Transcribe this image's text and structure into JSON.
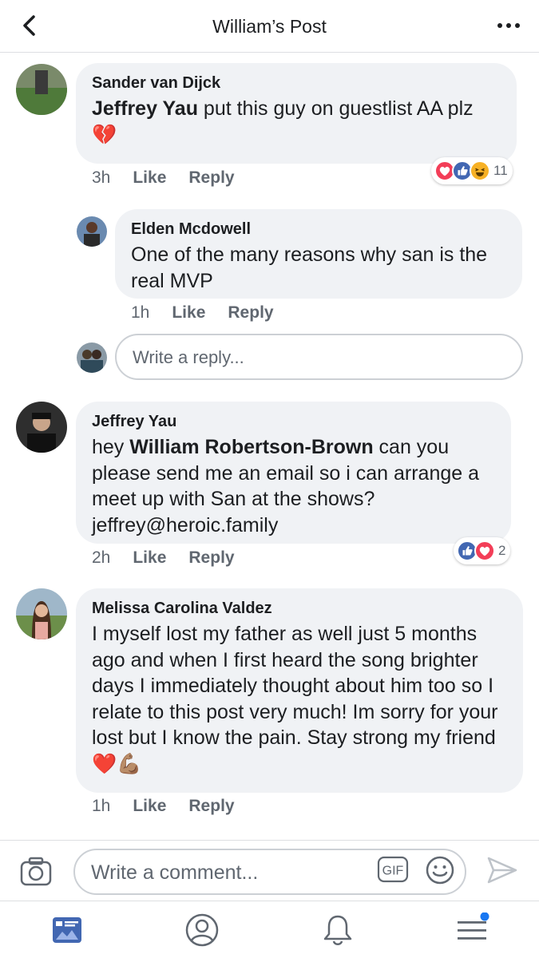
{
  "header": {
    "title": "William’s Post"
  },
  "comments": [
    {
      "author": "Sander van Dijck",
      "mention": "Jeffrey Yau",
      "text": " put this guy on guestlist AA plz",
      "emoji": "💔",
      "time": "3h",
      "like_label": "Like",
      "reply_label": "Reply",
      "reaction_count": "11"
    },
    {
      "author": "Elden Mcdowell",
      "text": "One of the many reasons why san is the real MVP",
      "time": "1h",
      "like_label": "Like",
      "reply_label": "Reply"
    },
    {
      "author": "Jeffrey Yau",
      "text_before": "hey ",
      "mention": "William Robertson-Brown",
      "text_after": " can you please send me an email so i can arrange a meet up with San at the shows? jeffrey@heroic.family",
      "time": "2h",
      "like_label": "Like",
      "reply_label": "Reply",
      "reaction_count": "2"
    },
    {
      "author": "Melissa Carolina Valdez",
      "text": "I myself lost my father as well just 5 months ago and when I first heard the song brighter days I immediately thought about him too so I relate to this post very much! Im sorry for your lost but I know the pain. Stay strong my friend ",
      "emoji": "❤️💪🏽",
      "time": "1h",
      "like_label": "Like",
      "reply_label": "Reply"
    }
  ],
  "reply_box": {
    "placeholder": "Write a reply..."
  },
  "composer": {
    "placeholder": "Write a comment...",
    "gif_label": "GIF"
  },
  "colors": {
    "accent": "#4267b2",
    "love": "#f33e58",
    "haha": "#f7b125",
    "notification_dot": "#1877f2",
    "bubble": "#f0f2f5",
    "meta": "#606770"
  },
  "icons": [
    "back-icon",
    "more-icon",
    "camera-icon",
    "gif-icon",
    "emoji-icon",
    "send-icon",
    "news-feed-icon",
    "profile-icon",
    "notifications-icon",
    "menu-icon"
  ]
}
